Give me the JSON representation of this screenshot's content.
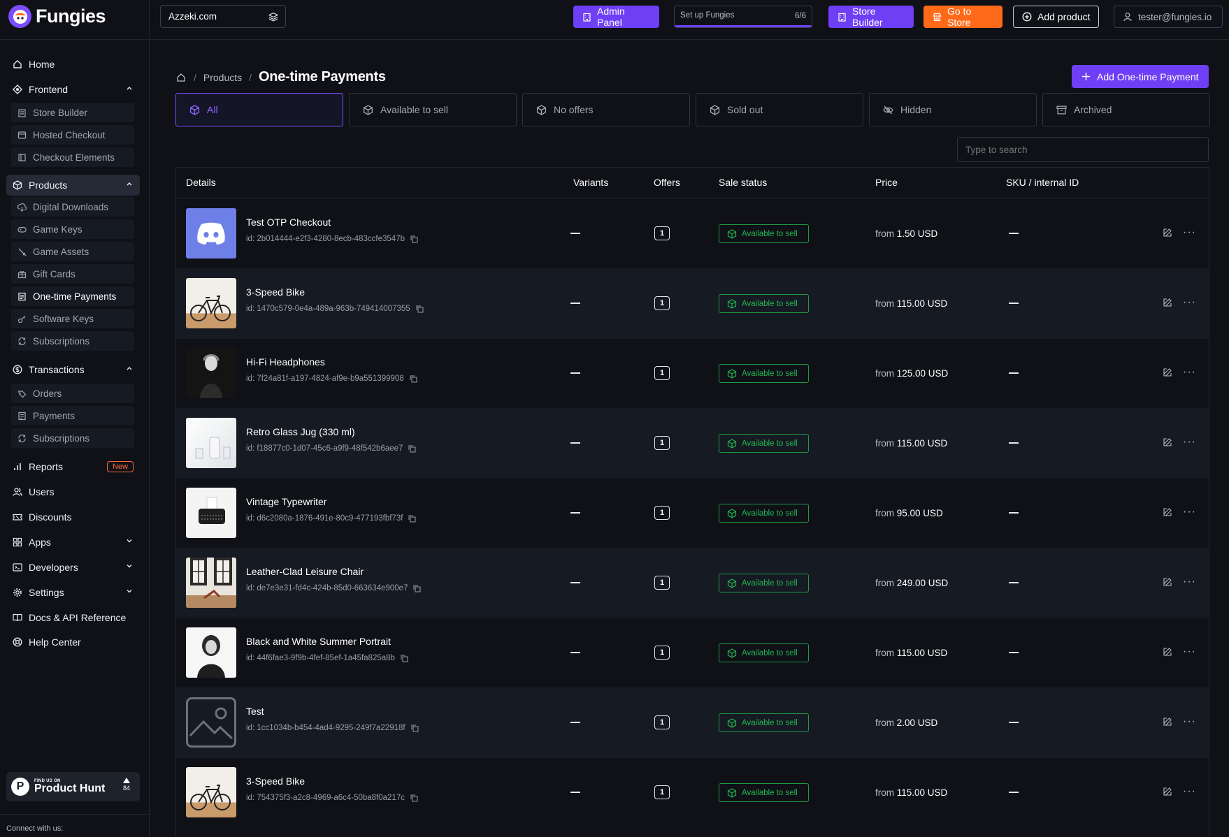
{
  "brand": {
    "name": "Fungies",
    "accent": "#6e3ff5",
    "orange": "#ff6a1a",
    "green": "#22b452"
  },
  "sidebar": {
    "home": "Home",
    "frontend": {
      "label": "Frontend",
      "items": [
        "Store Builder",
        "Hosted Checkout",
        "Checkout Elements"
      ]
    },
    "products": {
      "label": "Products",
      "items": [
        "Digital Downloads",
        "Game Keys",
        "Game Assets",
        "Gift Cards",
        "One-time Payments",
        "Software Keys",
        "Subscriptions"
      ]
    },
    "transactions": {
      "label": "Transactions",
      "items": [
        "Orders",
        "Payments",
        "Subscriptions"
      ]
    },
    "reports": "Reports",
    "reports_badge": "New",
    "users": "Users",
    "discounts": "Discounts",
    "apps": "Apps",
    "developers": "Developers",
    "settings": "Settings",
    "docs": "Docs & API Reference",
    "help": "Help Center",
    "product_hunt": {
      "small": "FIND US ON",
      "name": "Product Hunt",
      "votes": "84"
    },
    "connect": "Connect with us:"
  },
  "topbar": {
    "store": "Azzeki.com",
    "admin_panel": "Admin Panel",
    "setup_label": "Set up Fungies",
    "setup_count": "6/6",
    "store_builder": "Store Builder",
    "go_to_store": "Go to Store",
    "add_product": "Add product",
    "user": "tester@fungies.io"
  },
  "page": {
    "breadcrumb_parent": "Products",
    "title": "One-time Payments",
    "add_button": "Add One-time Payment",
    "search_placeholder": "Type to search"
  },
  "filters": [
    "All",
    "Available to sell",
    "No offers",
    "Sold out",
    "Hidden",
    "Archived"
  ],
  "table": {
    "headers": [
      "Details",
      "Variants",
      "Offers",
      "Sale status",
      "Price",
      "SKU / internal ID"
    ],
    "price_prefix": "from",
    "rows": [
      {
        "name": "Test OTP Checkout",
        "id": "id: 2b014444-e2f3-4280-8ecb-483ccfe3547b",
        "offers": "1",
        "status": "Available to sell",
        "price": "1.50 USD",
        "thumb": "discord"
      },
      {
        "name": "3-Speed Bike",
        "id": "id: 1470c579-0e4a-489a-963b-749414007355",
        "offers": "1",
        "status": "Available to sell",
        "price": "115.00 USD",
        "thumb": "bike"
      },
      {
        "name": "Hi-Fi Headphones",
        "id": "id: 7f24a81f-a197-4824-af9e-b9a551399908",
        "offers": "1",
        "status": "Available to sell",
        "price": "125.00 USD",
        "thumb": "dark"
      },
      {
        "name": "Retro Glass Jug (330 ml)",
        "id": "id: f18877c0-1d07-45c6-a9f9-48f542b6aee7",
        "offers": "1",
        "status": "Available to sell",
        "price": "115.00 USD",
        "thumb": "jug"
      },
      {
        "name": "Vintage Typewriter",
        "id": "id: d6c2080a-1876-491e-80c9-477193fbf73f",
        "offers": "1",
        "status": "Available to sell",
        "price": "95.00 USD",
        "thumb": "typewriter"
      },
      {
        "name": "Leather-Clad Leisure Chair",
        "id": "id: de7e3e31-fd4c-424b-85d0-663634e900e7",
        "offers": "1",
        "status": "Available to sell",
        "price": "249.00 USD",
        "thumb": "chair"
      },
      {
        "name": "Black and White Summer Portrait",
        "id": "id: 44f6fae3-9f9b-4fef-85ef-1a45fa825a8b",
        "offers": "1",
        "status": "Available to sell",
        "price": "115.00 USD",
        "thumb": "portrait"
      },
      {
        "name": "Test",
        "id": "id: 1cc1034b-b454-4ad4-9295-249f7a22918f",
        "offers": "1",
        "status": "Available to sell",
        "price": "2.00 USD",
        "thumb": "placeholder"
      },
      {
        "name": "3-Speed Bike",
        "id": "id: 754375f3-a2c8-4969-a6c4-50ba8f0a217c",
        "offers": "1",
        "status": "Available to sell",
        "price": "115.00 USD",
        "thumb": "bike"
      }
    ]
  }
}
